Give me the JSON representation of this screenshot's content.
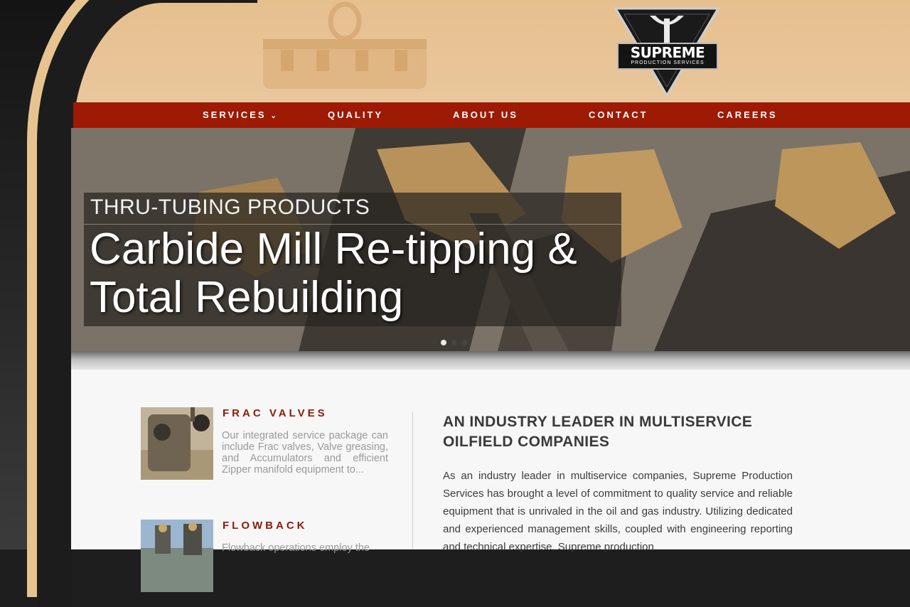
{
  "brand": {
    "name": "SUPREME",
    "subtitle": "PRODUCTION SERVICES",
    "colors": {
      "primary_red": "#9d1a05",
      "tan": "#e6bf8e",
      "gold": "#e7c48f",
      "dark": "#1c1c1c"
    }
  },
  "nav": {
    "items": [
      {
        "label": "SERVICES",
        "has_dropdown": true,
        "icon": "chevron-down-icon"
      },
      {
        "label": "QUALITY"
      },
      {
        "label": "ABOUT US"
      },
      {
        "label": "CONTACT"
      },
      {
        "label": "CAREERS"
      }
    ]
  },
  "hero": {
    "eyebrow": "THRU-TUBING PRODUCTS",
    "headline": "Carbide Mill Re-tipping & Total Rebuilding",
    "slides": 3,
    "active_slide": 1
  },
  "services": [
    {
      "title": "FRAC VALVES",
      "text": "Our integrated service package can include Frac valves, Valve greasing, and Accumulators and efficient Zipper manifold equipment to..."
    },
    {
      "title": "FLOWBACK",
      "text": "Flowback operations employ the"
    }
  ],
  "intro": {
    "title": "AN INDUSTRY LEADER IN MULTISERVICE OILFIELD COMPANIES",
    "body": "As an industry leader in multiservice companies, Supreme Production Services has brought a level of commitment to quality service and reliable equipment that is unrivaled in the oil and gas industry. Utilizing dedicated and experienced management skills, coupled with engineering reporting and technical expertise, Supreme production"
  }
}
